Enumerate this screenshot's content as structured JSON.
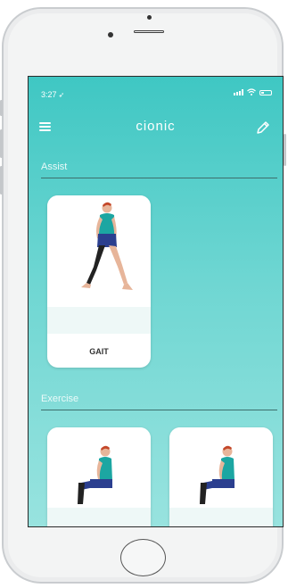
{
  "status_bar": {
    "time": "3:27",
    "location_icon": "location-arrow-icon"
  },
  "header": {
    "brand": "cionic",
    "menu_icon": "hamburger-menu-icon",
    "edit_icon": "pencil-icon"
  },
  "sections": {
    "assist": {
      "title": "Assist",
      "cards": [
        {
          "label": "GAIT"
        }
      ]
    },
    "exercise": {
      "title": "Exercise"
    }
  },
  "colors": {
    "screen_top": "#3fc7c3",
    "screen_bottom": "#98e3df",
    "divider": "#3d6e6c",
    "card": "#ffffff"
  }
}
